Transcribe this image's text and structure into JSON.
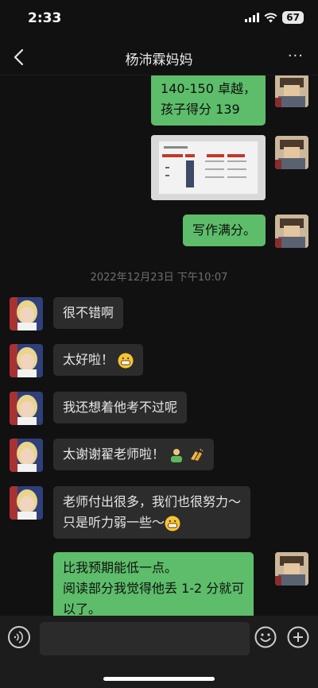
{
  "status_bar": {
    "time": "2:33",
    "battery": "67",
    "icons": [
      "signal-icon",
      "wifi-icon",
      "battery-icon"
    ]
  },
  "header": {
    "title": "杨沛霖妈妈",
    "back_icon": "chevron-left-icon",
    "more_icon": "more-dots-icon",
    "more_label": "···"
  },
  "messages": {
    "m1": {
      "line1": "140-150 卓越，",
      "line2": "孩子得分 139"
    },
    "m2_image": "image-message",
    "m3": {
      "text": "写作满分。"
    },
    "timestamp": "2022年12月23日 下午10:07",
    "m4": {
      "text": "很不错啊"
    },
    "m5": {
      "text": "太好啦！",
      "emoji": "grin-emoji"
    },
    "m6": {
      "text": "我还想着他考不过呢"
    },
    "m7": {
      "text": "太谢谢翟老师啦！",
      "emoji": [
        "person-emoji",
        "clapping-hands-emoji"
      ]
    },
    "m8": {
      "line1": "老师付出很多，我们也很努力～",
      "line2": "只是听力弱一些～",
      "emoji": "grin-emoji"
    },
    "m9": {
      "line1": "比我预期能低一点。",
      "line2": "阅读部分我觉得他丢 1-2 分就可",
      "line3": "以了。"
    }
  },
  "input_bar": {
    "voice_icon": "voice-icon",
    "emoji_icon": "emoji-icon",
    "plus_icon": "plus-icon",
    "input_value": ""
  },
  "colors": {
    "background": "#111111",
    "sent_bubble": "#5dbd6a",
    "received_bubble": "#2c2c2c",
    "timestamp_text": "#6f6f6f"
  }
}
